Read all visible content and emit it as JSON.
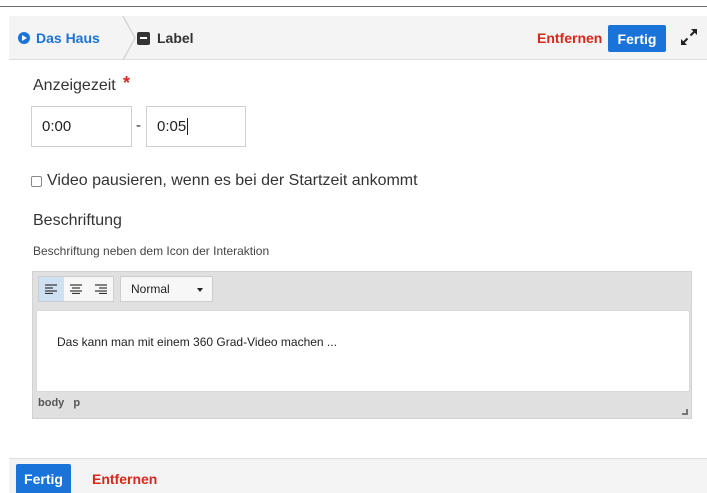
{
  "breadcrumb": {
    "home_label": "Das Haus",
    "home_icon": "play-circle-icon",
    "current_label": "Label",
    "current_icon": "label-icon"
  },
  "header": {
    "remove_label": "Entfernen",
    "done_label": "Fertig",
    "expand_icon": "expand-icon"
  },
  "form": {
    "display_time_label": "Anzeigezeit",
    "required_marker": "*",
    "start_time": "0:00",
    "time_separator": "-",
    "end_time": "0:05",
    "pause_checkbox_label": "Video pausieren, wenn es bei der Startzeit ankommt",
    "pause_checked": false,
    "caption_title": "Beschriftung",
    "caption_description": "Beschriftung neben dem Icon der Interaktion"
  },
  "editor": {
    "align_buttons": [
      "align-left-icon",
      "align-center-icon",
      "align-right-icon"
    ],
    "active_align": "align-left-icon",
    "format_value": "Normal",
    "content": "Das kann man mit einem 360 Grad-Video machen ...",
    "path_items": [
      "body",
      "p"
    ]
  },
  "footer": {
    "done_label": "Fertig",
    "remove_label": "Entfernen"
  },
  "colors": {
    "accent_blue": "#1a73d9",
    "danger_red": "#d42a1c",
    "header_bg": "#f4f4f4"
  }
}
